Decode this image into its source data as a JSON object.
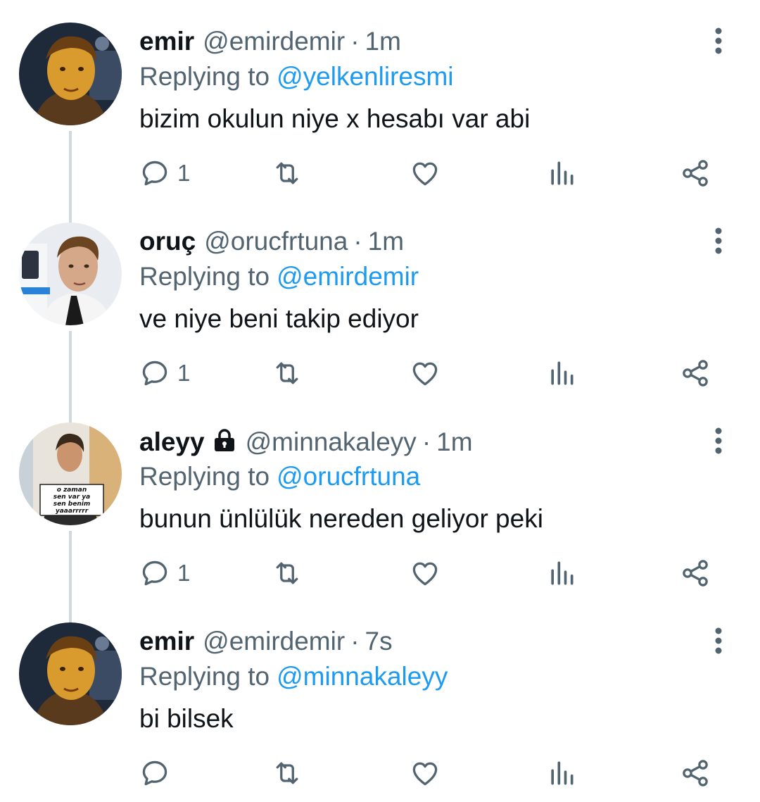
{
  "colors": {
    "text_primary": "#0f1419",
    "text_secondary": "#536471",
    "link": "#1d9bf0",
    "thread_line": "#cfd9de",
    "icon": "#536471"
  },
  "tweets": [
    {
      "name": "emir",
      "handle": "@emirdemir",
      "separator": "·",
      "time": "1m",
      "replying_label": "Replying to",
      "replying_to": "@yelkenliresmi",
      "text": "bizim okulun niye x hesabı var abi",
      "reply_count": "1",
      "locked": false
    },
    {
      "name": "oruç",
      "handle": "@orucfrtuna",
      "separator": "·",
      "time": "1m",
      "replying_label": "Replying to",
      "replying_to": "@emirdemir",
      "text": "ve niye beni takip ediyor",
      "reply_count": "1",
      "locked": false
    },
    {
      "name": "aleyy",
      "handle": "@minnakaleyy",
      "separator": "·",
      "time": "1m",
      "replying_label": "Replying to",
      "replying_to": "@orucfrtuna",
      "text": "bunun ünlülük nereden geliyor peki",
      "reply_count": "1",
      "locked": true,
      "avatar_sign_text": [
        "o zaman",
        "sen var ya",
        "sen benim",
        "yaaarrrrr"
      ]
    },
    {
      "name": "emir",
      "handle": "@emirdemir",
      "separator": "·",
      "time": "7s",
      "replying_label": "Replying to",
      "replying_to": "@minnakaleyy",
      "text": "bi bilsek",
      "reply_count": "",
      "locked": false
    }
  ],
  "icons": {
    "more": "more-vertical-icon",
    "reply": "reply-icon",
    "retweet": "retweet-icon",
    "like": "heart-icon",
    "views": "views-icon",
    "share": "share-icon",
    "lock": "lock-icon"
  }
}
